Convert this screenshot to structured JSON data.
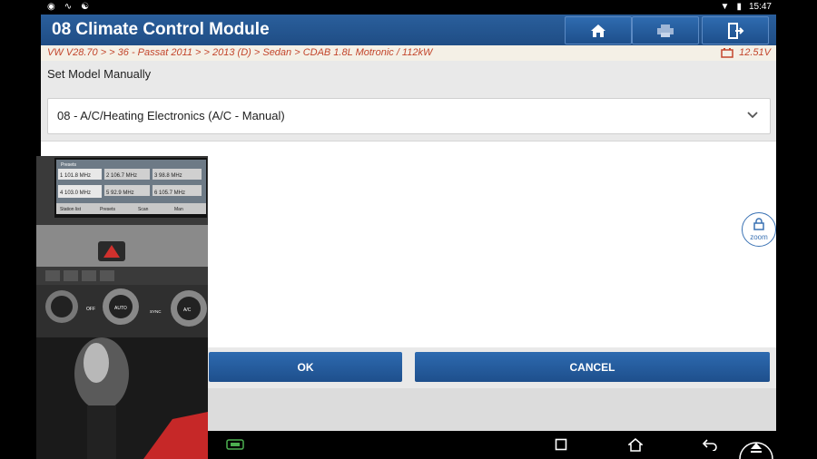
{
  "status_bar": {
    "time": "15:47",
    "left_icons": [
      "eye-icon",
      "debug-icon",
      "usb-icon"
    ],
    "right_icons": [
      "wifi-icon",
      "battery-icon"
    ]
  },
  "app": {
    "title": "08 Climate Control Module",
    "toolbar": {
      "home": "home-icon",
      "print": "print-icon",
      "exit": "exit-icon"
    },
    "breadcrumb": "VW V28.70 >  > 36 - Passat 2011 > > 2013 (D) > Sedan > CDAB 1.8L Motronic / 112kW",
    "battery_voltage": "12.51V",
    "section_label": "Set Model Manually",
    "selected_option": "08 - A/C/Heating Electronics (A/C - Manual)",
    "zoom_label": "zoom",
    "ok_label": "OK",
    "cancel_label": "CANCEL"
  },
  "inset_photo": {
    "radio": {
      "header": "Presets",
      "presets": [
        "1  101.8 MHz",
        "2  106.7 MHz",
        "3  98.8 MHz",
        "4  103.0 MHz",
        "5  92.9 MHz",
        "6  105.7 MHz"
      ],
      "tabs": [
        "Station list",
        "Presets",
        "Scan",
        "Man"
      ]
    },
    "climate": {
      "auto_label": "AUTO",
      "off_label": "OFF",
      "ac_label": "A/C",
      "sync_label": "SYNC"
    }
  },
  "colors": {
    "accent": "#1f4d85",
    "breadcrumb_text": "#c3462c"
  }
}
